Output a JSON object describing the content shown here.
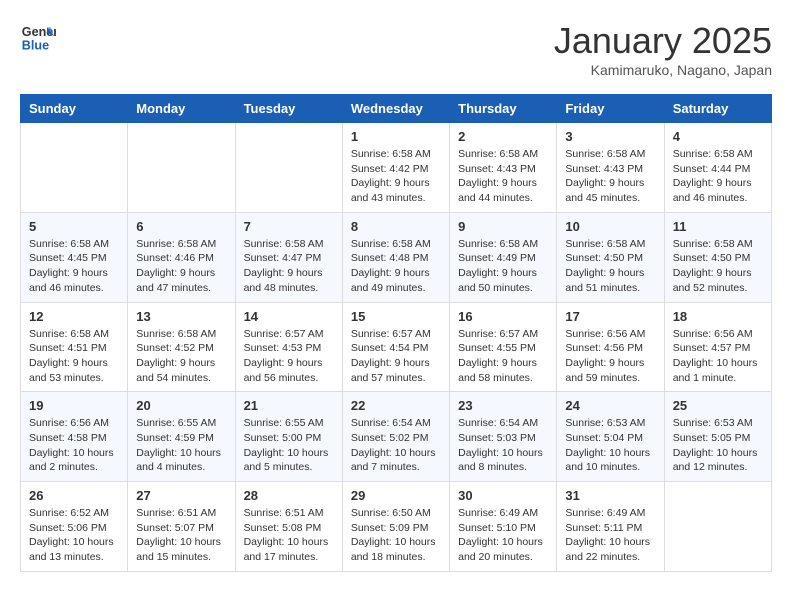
{
  "header": {
    "logo_line1": "General",
    "logo_line2": "Blue",
    "month": "January 2025",
    "location": "Kamimaruko, Nagano, Japan"
  },
  "weekdays": [
    "Sunday",
    "Monday",
    "Tuesday",
    "Wednesday",
    "Thursday",
    "Friday",
    "Saturday"
  ],
  "weeks": [
    [
      {
        "day": "",
        "info": ""
      },
      {
        "day": "",
        "info": ""
      },
      {
        "day": "",
        "info": ""
      },
      {
        "day": "1",
        "info": "Sunrise: 6:58 AM\nSunset: 4:42 PM\nDaylight: 9 hours\nand 43 minutes."
      },
      {
        "day": "2",
        "info": "Sunrise: 6:58 AM\nSunset: 4:43 PM\nDaylight: 9 hours\nand 44 minutes."
      },
      {
        "day": "3",
        "info": "Sunrise: 6:58 AM\nSunset: 4:43 PM\nDaylight: 9 hours\nand 45 minutes."
      },
      {
        "day": "4",
        "info": "Sunrise: 6:58 AM\nSunset: 4:44 PM\nDaylight: 9 hours\nand 46 minutes."
      }
    ],
    [
      {
        "day": "5",
        "info": "Sunrise: 6:58 AM\nSunset: 4:45 PM\nDaylight: 9 hours\nand 46 minutes."
      },
      {
        "day": "6",
        "info": "Sunrise: 6:58 AM\nSunset: 4:46 PM\nDaylight: 9 hours\nand 47 minutes."
      },
      {
        "day": "7",
        "info": "Sunrise: 6:58 AM\nSunset: 4:47 PM\nDaylight: 9 hours\nand 48 minutes."
      },
      {
        "day": "8",
        "info": "Sunrise: 6:58 AM\nSunset: 4:48 PM\nDaylight: 9 hours\nand 49 minutes."
      },
      {
        "day": "9",
        "info": "Sunrise: 6:58 AM\nSunset: 4:49 PM\nDaylight: 9 hours\nand 50 minutes."
      },
      {
        "day": "10",
        "info": "Sunrise: 6:58 AM\nSunset: 4:50 PM\nDaylight: 9 hours\nand 51 minutes."
      },
      {
        "day": "11",
        "info": "Sunrise: 6:58 AM\nSunset: 4:50 PM\nDaylight: 9 hours\nand 52 minutes."
      }
    ],
    [
      {
        "day": "12",
        "info": "Sunrise: 6:58 AM\nSunset: 4:51 PM\nDaylight: 9 hours\nand 53 minutes."
      },
      {
        "day": "13",
        "info": "Sunrise: 6:58 AM\nSunset: 4:52 PM\nDaylight: 9 hours\nand 54 minutes."
      },
      {
        "day": "14",
        "info": "Sunrise: 6:57 AM\nSunset: 4:53 PM\nDaylight: 9 hours\nand 56 minutes."
      },
      {
        "day": "15",
        "info": "Sunrise: 6:57 AM\nSunset: 4:54 PM\nDaylight: 9 hours\nand 57 minutes."
      },
      {
        "day": "16",
        "info": "Sunrise: 6:57 AM\nSunset: 4:55 PM\nDaylight: 9 hours\nand 58 minutes."
      },
      {
        "day": "17",
        "info": "Sunrise: 6:56 AM\nSunset: 4:56 PM\nDaylight: 9 hours\nand 59 minutes."
      },
      {
        "day": "18",
        "info": "Sunrise: 6:56 AM\nSunset: 4:57 PM\nDaylight: 10 hours\nand 1 minute."
      }
    ],
    [
      {
        "day": "19",
        "info": "Sunrise: 6:56 AM\nSunset: 4:58 PM\nDaylight: 10 hours\nand 2 minutes."
      },
      {
        "day": "20",
        "info": "Sunrise: 6:55 AM\nSunset: 4:59 PM\nDaylight: 10 hours\nand 4 minutes."
      },
      {
        "day": "21",
        "info": "Sunrise: 6:55 AM\nSunset: 5:00 PM\nDaylight: 10 hours\nand 5 minutes."
      },
      {
        "day": "22",
        "info": "Sunrise: 6:54 AM\nSunset: 5:02 PM\nDaylight: 10 hours\nand 7 minutes."
      },
      {
        "day": "23",
        "info": "Sunrise: 6:54 AM\nSunset: 5:03 PM\nDaylight: 10 hours\nand 8 minutes."
      },
      {
        "day": "24",
        "info": "Sunrise: 6:53 AM\nSunset: 5:04 PM\nDaylight: 10 hours\nand 10 minutes."
      },
      {
        "day": "25",
        "info": "Sunrise: 6:53 AM\nSunset: 5:05 PM\nDaylight: 10 hours\nand 12 minutes."
      }
    ],
    [
      {
        "day": "26",
        "info": "Sunrise: 6:52 AM\nSunset: 5:06 PM\nDaylight: 10 hours\nand 13 minutes."
      },
      {
        "day": "27",
        "info": "Sunrise: 6:51 AM\nSunset: 5:07 PM\nDaylight: 10 hours\nand 15 minutes."
      },
      {
        "day": "28",
        "info": "Sunrise: 6:51 AM\nSunset: 5:08 PM\nDaylight: 10 hours\nand 17 minutes."
      },
      {
        "day": "29",
        "info": "Sunrise: 6:50 AM\nSunset: 5:09 PM\nDaylight: 10 hours\nand 18 minutes."
      },
      {
        "day": "30",
        "info": "Sunrise: 6:49 AM\nSunset: 5:10 PM\nDaylight: 10 hours\nand 20 minutes."
      },
      {
        "day": "31",
        "info": "Sunrise: 6:49 AM\nSunset: 5:11 PM\nDaylight: 10 hours\nand 22 minutes."
      },
      {
        "day": "",
        "info": ""
      }
    ]
  ]
}
